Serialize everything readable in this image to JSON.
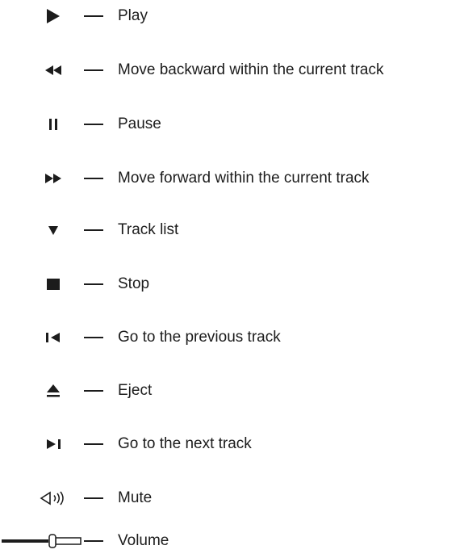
{
  "legend": [
    {
      "icon": "play-icon",
      "label": "Play"
    },
    {
      "icon": "rewind-icon",
      "label": "Move backward within the current track"
    },
    {
      "icon": "pause-icon",
      "label": "Pause"
    },
    {
      "icon": "fast-forward-icon",
      "label": "Move forward within the current track"
    },
    {
      "icon": "track-list-icon",
      "label": "Track list"
    },
    {
      "icon": "stop-icon",
      "label": "Stop"
    },
    {
      "icon": "previous-track-icon",
      "label": "Go to the previous track"
    },
    {
      "icon": "eject-icon",
      "label": "Eject"
    },
    {
      "icon": "next-track-icon",
      "label": "Go to the next track"
    },
    {
      "icon": "mute-icon",
      "label": "Mute"
    },
    {
      "icon": "volume-slider-icon",
      "label": "Volume"
    }
  ],
  "colors": {
    "ink": "#1c1c1c"
  }
}
